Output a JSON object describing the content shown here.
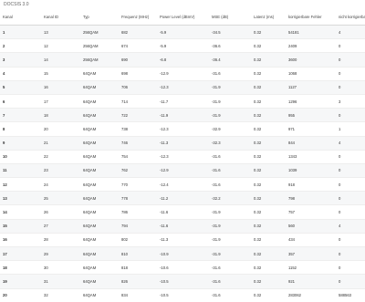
{
  "section_title": "DOCSIS 3.0",
  "table": {
    "headers": [
      "Kanal",
      "Kanal ID",
      "Typ",
      "Frequenz (MHz)",
      "Power Level (dBmV)",
      "MSE (dB)",
      "Latenz (ms)",
      "korrigierbare Fehler",
      "nicht korrigierbare Fehler"
    ],
    "rows": [
      [
        "1",
        "13",
        "256QAM",
        "682",
        "-5.9",
        "-34.5",
        "0.32",
        "54181",
        "4"
      ],
      [
        "2",
        "12",
        "256QAM",
        "674",
        "-5.9",
        "-36.6",
        "0.32",
        "2409",
        "0"
      ],
      [
        "3",
        "14",
        "256QAM",
        "690",
        "-6.8",
        "-36.4",
        "0.32",
        "3600",
        "0"
      ],
      [
        "4",
        "15",
        "64QAM",
        "698",
        "-12.9",
        "-31.6",
        "0.32",
        "1068",
        "0"
      ],
      [
        "5",
        "16",
        "64QAM",
        "706",
        "-12.3",
        "-31.9",
        "0.32",
        "1127",
        "0"
      ],
      [
        "6",
        "17",
        "64QAM",
        "714",
        "-11.7",
        "-31.9",
        "0.32",
        "1296",
        "3"
      ],
      [
        "7",
        "18",
        "64QAM",
        "722",
        "-11.9",
        "-31.9",
        "0.32",
        "955",
        "0"
      ],
      [
        "8",
        "20",
        "64QAM",
        "738",
        "-12.3",
        "-32.9",
        "0.32",
        "971",
        "1"
      ],
      [
        "9",
        "21",
        "64QAM",
        "746",
        "-11.3",
        "-32.3",
        "0.32",
        "844",
        "4"
      ],
      [
        "10",
        "22",
        "64QAM",
        "754",
        "-12.3",
        "-31.6",
        "0.32",
        "1343",
        "0"
      ],
      [
        "11",
        "23",
        "64QAM",
        "762",
        "-12.9",
        "-31.6",
        "0.32",
        "1039",
        "0"
      ],
      [
        "12",
        "24",
        "64QAM",
        "770",
        "-12.4",
        "-31.6",
        "0.32",
        "918",
        "0"
      ],
      [
        "13",
        "25",
        "64QAM",
        "778",
        "-11.2",
        "-32.2",
        "0.32",
        "798",
        "0"
      ],
      [
        "14",
        "26",
        "64QAM",
        "786",
        "-11.6",
        "-31.9",
        "0.32",
        "757",
        "0"
      ],
      [
        "15",
        "27",
        "64QAM",
        "794",
        "-11.6",
        "-31.9",
        "0.32",
        "560",
        "4"
      ],
      [
        "16",
        "28",
        "64QAM",
        "802",
        "-11.3",
        "-31.9",
        "0.32",
        "434",
        "0"
      ],
      [
        "17",
        "29",
        "64QAM",
        "810",
        "-10.9",
        "-31.9",
        "0.32",
        "357",
        "0"
      ],
      [
        "18",
        "30",
        "64QAM",
        "818",
        "-10.6",
        "-31.6",
        "0.32",
        "1152",
        "0"
      ],
      [
        "19",
        "31",
        "64QAM",
        "826",
        "-10.5",
        "-31.6",
        "0.32",
        "921",
        "0"
      ],
      [
        "20",
        "32",
        "64QAM",
        "834",
        "-10.5",
        "-31.6",
        "0.32",
        "283062",
        "588563"
      ]
    ]
  }
}
